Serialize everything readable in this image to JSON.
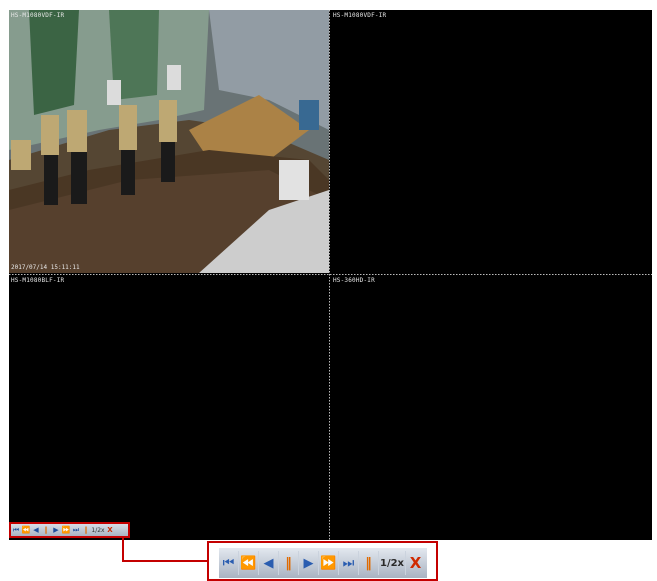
{
  "cameras": [
    {
      "label": "HS-M1080VDF-IR",
      "timestamp": "2017/07/14 15:11:11"
    },
    {
      "label": "HS-M1080VDF-IR",
      "timestamp": ""
    },
    {
      "label": "HS-M1080BLF-IR",
      "timestamp": ""
    },
    {
      "label": "HS-360HD-IR",
      "timestamp": ""
    }
  ],
  "toolbar": {
    "first_icon": "skip-to-start-icon",
    "fast_backward_icon": "fast-backward-icon",
    "step_backward_icon": "step-backward-icon",
    "pause_icon": "pause-icon",
    "play_icon": "play-icon",
    "fast_forward_icon": "fast-forward-icon",
    "last_icon": "skip-to-end-icon",
    "pause2_icon": "pause-icon",
    "speed_label": "1/2x",
    "close_label": "X"
  },
  "colors": {
    "highlight": "#c40000",
    "icon_blue": "#2a5db0",
    "pause_orange": "#e06a00"
  }
}
